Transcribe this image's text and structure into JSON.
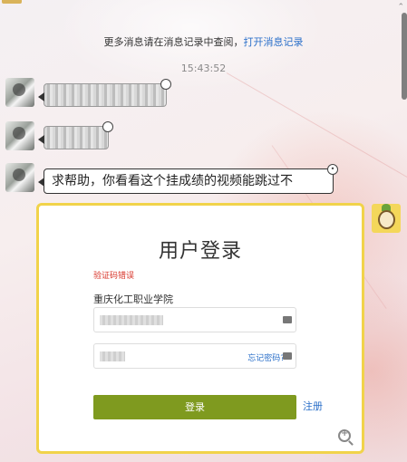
{
  "chat": {
    "notice_text": "更多消息请在消息记录中查阅，",
    "notice_link": "打开消息记录",
    "timestamp": "15:43:52",
    "messages": [
      {
        "sender": "contact",
        "text": "",
        "blurred": true
      },
      {
        "sender": "contact",
        "text": "",
        "blurred": true
      },
      {
        "sender": "contact",
        "text": "求帮助，你看看这个挂成绩的视频能跳过不",
        "blurred": false
      }
    ]
  },
  "screenshot": {
    "title": "用户登录",
    "error": "验证码错误",
    "school": "重庆化工职业学院",
    "username_value": "",
    "password_value": "",
    "forgot_label": "忘记密码?",
    "login_button": "登录",
    "register_link": "注册"
  },
  "colors": {
    "link": "#2a6fc9",
    "error": "#d8352a",
    "login_button": "#7f9a1f",
    "image_border": "#f1d34a"
  },
  "icons": {
    "contact_avatar": "avatar",
    "self_avatar": "avatar",
    "zoom": "zoom-in-icon",
    "keyboard": "keyboard-icon"
  }
}
